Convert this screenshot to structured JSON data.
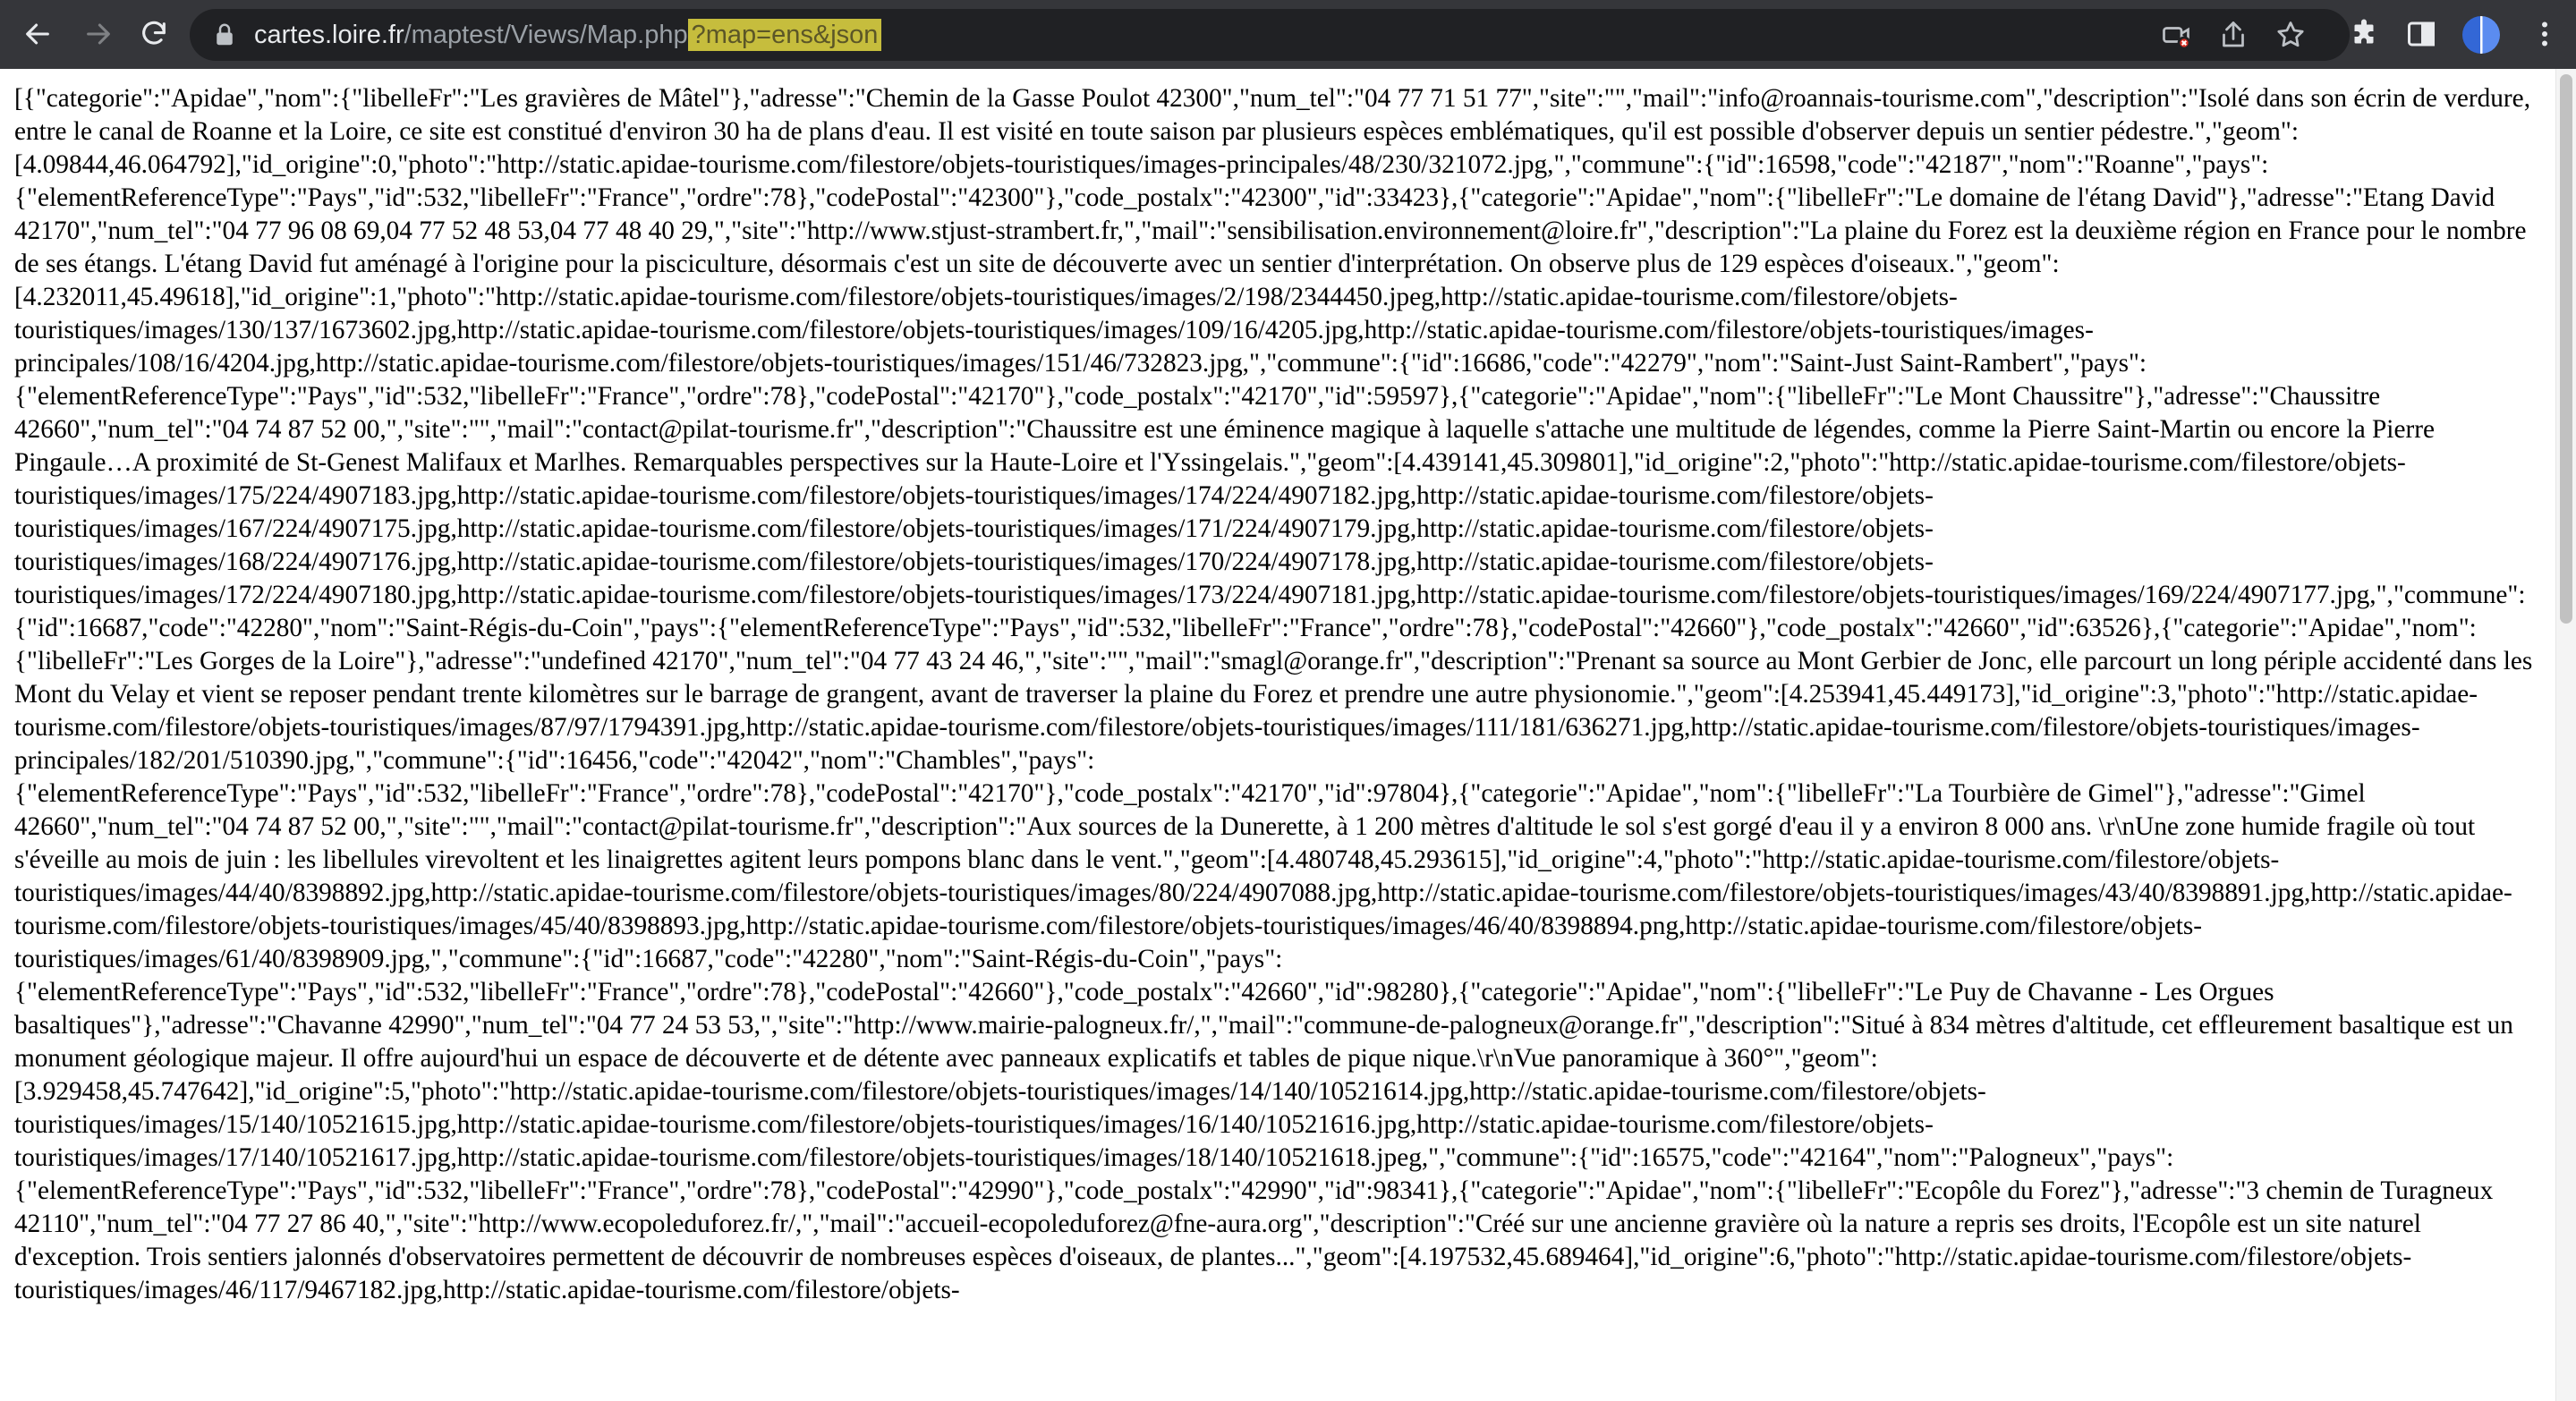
{
  "browser": {
    "url_host": "cartes.loire.fr",
    "url_path": "/maptest/Views/Map.php",
    "url_query": "?map=ens&json"
  },
  "icons": {
    "back": "arrow-left-icon",
    "forward": "arrow-right-icon",
    "reload": "reload-icon",
    "site_info": "lock-icon",
    "blocked": "camera-blocked-icon",
    "share": "share-icon",
    "bookmark": "star-icon",
    "extensions": "puzzle-icon",
    "sidebar": "side-panel-icon",
    "profile": "avatar",
    "menu": "kebab-menu-icon"
  },
  "colors": {
    "toolbar": "#35363a",
    "omnibox": "#202124",
    "highlight": "#c6bd3d"
  },
  "page": {
    "json_text": "[{\"categorie\":\"Apidae\",\"nom\":{\"libelleFr\":\"Les gravières de Mâtel\"},\"adresse\":\"Chemin de la Gasse Poulot 42300\",\"num_tel\":\"04 77 71 51 77\",\"site\":\"\",\"mail\":\"info@roannais-tourisme.com\",\"description\":\"Isolé dans son écrin de verdure, entre le canal de Roanne et la Loire, ce site est constitué d'environ 30 ha de plans d'eau. Il est visité en toute saison par plusieurs espèces emblématiques, qu'il est possible d'observer depuis un sentier pédestre.\",\"geom\":[4.09844,46.064792],\"id_origine\":0,\"photo\":\"http://static.apidae-tourisme.com/filestore/objets-touristiques/images-principales/48/230/321072.jpg,\",\"commune\":{\"id\":16598,\"code\":\"42187\",\"nom\":\"Roanne\",\"pays\":{\"elementReferenceType\":\"Pays\",\"id\":532,\"libelleFr\":\"France\",\"ordre\":78},\"codePostal\":\"42300\"},\"code_postalx\":\"42300\",\"id\":33423},{\"categorie\":\"Apidae\",\"nom\":{\"libelleFr\":\"Le domaine de l'étang David\"},\"adresse\":\"Etang David 42170\",\"num_tel\":\"04 77 96 08 69,04 77 52 48 53,04 77 48 40 29,\",\"site\":\"http://www.stjust-strambert.fr,\",\"mail\":\"sensibilisation.environnement@loire.fr\",\"description\":\"La plaine du Forez est la deuxième région en France pour le nombre de ses étangs. L'étang David fut aménagé à l'origine pour la pisciculture, désormais c'est un site de découverte avec un sentier d'interprétation. On observe plus de 129 espèces d'oiseaux.\",\"geom\":[4.232011,45.49618],\"id_origine\":1,\"photo\":\"http://static.apidae-tourisme.com/filestore/objets-touristiques/images/2/198/2344450.jpeg,http://static.apidae-tourisme.com/filestore/objets-touristiques/images/130/137/1673602.jpg,http://static.apidae-tourisme.com/filestore/objets-touristiques/images/109/16/4205.jpg,http://static.apidae-tourisme.com/filestore/objets-touristiques/images-principales/108/16/4204.jpg,http://static.apidae-tourisme.com/filestore/objets-touristiques/images/151/46/732823.jpg,\",\"commune\":{\"id\":16686,\"code\":\"42279\",\"nom\":\"Saint-Just Saint-Rambert\",\"pays\":{\"elementReferenceType\":\"Pays\",\"id\":532,\"libelleFr\":\"France\",\"ordre\":78},\"codePostal\":\"42170\"},\"code_postalx\":\"42170\",\"id\":59597},{\"categorie\":\"Apidae\",\"nom\":{\"libelleFr\":\"Le Mont Chaussitre\"},\"adresse\":\"Chaussitre 42660\",\"num_tel\":\"04 74 87 52 00,\",\"site\":\"\",\"mail\":\"contact@pilat-tourisme.fr\",\"description\":\"Chaussitre est une éminence magique à laquelle s'attache une multitude de légendes, comme la Pierre Saint-Martin ou encore la Pierre Pingaule…A proximité de St-Genest Malifaux et Marlhes. Remarquables perspectives sur la Haute-Loire et l'Yssingelais.\",\"geom\":[4.439141,45.309801],\"id_origine\":2,\"photo\":\"http://static.apidae-tourisme.com/filestore/objets-touristiques/images/175/224/4907183.jpg,http://static.apidae-tourisme.com/filestore/objets-touristiques/images/174/224/4907182.jpg,http://static.apidae-tourisme.com/filestore/objets-touristiques/images/167/224/4907175.jpg,http://static.apidae-tourisme.com/filestore/objets-touristiques/images/171/224/4907179.jpg,http://static.apidae-tourisme.com/filestore/objets-touristiques/images/168/224/4907176.jpg,http://static.apidae-tourisme.com/filestore/objets-touristiques/images/170/224/4907178.jpg,http://static.apidae-tourisme.com/filestore/objets-touristiques/images/172/224/4907180.jpg,http://static.apidae-tourisme.com/filestore/objets-touristiques/images/173/224/4907181.jpg,http://static.apidae-tourisme.com/filestore/objets-touristiques/images/169/224/4907177.jpg,\",\"commune\":{\"id\":16687,\"code\":\"42280\",\"nom\":\"Saint-Régis-du-Coin\",\"pays\":{\"elementReferenceType\":\"Pays\",\"id\":532,\"libelleFr\":\"France\",\"ordre\":78},\"codePostal\":\"42660\"},\"code_postalx\":\"42660\",\"id\":63526},{\"categorie\":\"Apidae\",\"nom\":{\"libelleFr\":\"Les Gorges de la Loire\"},\"adresse\":\"undefined 42170\",\"num_tel\":\"04 77 43 24 46,\",\"site\":\"\",\"mail\":\"smagl@orange.fr\",\"description\":\"Prenant sa source au Mont Gerbier de Jonc, elle parcourt un long périple accidenté dans les Mont du Velay et vient se reposer pendant trente kilomètres sur le barrage de grangent, avant de traverser la plaine du Forez et prendre une autre physionomie.\",\"geom\":[4.253941,45.449173],\"id_origine\":3,\"photo\":\"http://static.apidae-tourisme.com/filestore/objets-touristiques/images/87/97/1794391.jpg,http://static.apidae-tourisme.com/filestore/objets-touristiques/images/111/181/636271.jpg,http://static.apidae-tourisme.com/filestore/objets-touristiques/images-principales/182/201/510390.jpg,\",\"commune\":{\"id\":16456,\"code\":\"42042\",\"nom\":\"Chambles\",\"pays\":{\"elementReferenceType\":\"Pays\",\"id\":532,\"libelleFr\":\"France\",\"ordre\":78},\"codePostal\":\"42170\"},\"code_postalx\":\"42170\",\"id\":97804},{\"categorie\":\"Apidae\",\"nom\":{\"libelleFr\":\"La Tourbière de Gimel\"},\"adresse\":\"Gimel 42660\",\"num_tel\":\"04 74 87 52 00,\",\"site\":\"\",\"mail\":\"contact@pilat-tourisme.fr\",\"description\":\"Aux sources de la Dunerette, à 1 200 mètres d'altitude le sol s'est gorgé d'eau il y a environ 8 000 ans. \\r\\nUne zone humide fragile où tout s'éveille au mois de juin : les libellules virevoltent et les linaigrettes agitent leurs pompons blanc dans le vent.\",\"geom\":[4.480748,45.293615],\"id_origine\":4,\"photo\":\"http://static.apidae-tourisme.com/filestore/objets-touristiques/images/44/40/8398892.jpg,http://static.apidae-tourisme.com/filestore/objets-touristiques/images/80/224/4907088.jpg,http://static.apidae-tourisme.com/filestore/objets-touristiques/images/43/40/8398891.jpg,http://static.apidae-tourisme.com/filestore/objets-touristiques/images/45/40/8398893.jpg,http://static.apidae-tourisme.com/filestore/objets-touristiques/images/46/40/8398894.png,http://static.apidae-tourisme.com/filestore/objets-touristiques/images/61/40/8398909.jpg,\",\"commune\":{\"id\":16687,\"code\":\"42280\",\"nom\":\"Saint-Régis-du-Coin\",\"pays\":{\"elementReferenceType\":\"Pays\",\"id\":532,\"libelleFr\":\"France\",\"ordre\":78},\"codePostal\":\"42660\"},\"code_postalx\":\"42660\",\"id\":98280},{\"categorie\":\"Apidae\",\"nom\":{\"libelleFr\":\"Le Puy de Chavanne - Les Orgues basaltiques\"},\"adresse\":\"Chavanne 42990\",\"num_tel\":\"04 77 24 53 53,\",\"site\":\"http://www.mairie-palogneux.fr/,\",\"mail\":\"commune-de-palogneux@orange.fr\",\"description\":\"Situé à 834 mètres d'altitude, cet effleurement basaltique est un monument géologique majeur. Il offre aujourd'hui un espace de découverte et de détente avec panneaux explicatifs et tables de pique nique.\\r\\nVue panoramique à 360°\",\"geom\":[3.929458,45.747642],\"id_origine\":5,\"photo\":\"http://static.apidae-tourisme.com/filestore/objets-touristiques/images/14/140/10521614.jpg,http://static.apidae-tourisme.com/filestore/objets-touristiques/images/15/140/10521615.jpg,http://static.apidae-tourisme.com/filestore/objets-touristiques/images/16/140/10521616.jpg,http://static.apidae-tourisme.com/filestore/objets-touristiques/images/17/140/10521617.jpg,http://static.apidae-tourisme.com/filestore/objets-touristiques/images/18/140/10521618.jpeg,\",\"commune\":{\"id\":16575,\"code\":\"42164\",\"nom\":\"Palogneux\",\"pays\":{\"elementReferenceType\":\"Pays\",\"id\":532,\"libelleFr\":\"France\",\"ordre\":78},\"codePostal\":\"42990\"},\"code_postalx\":\"42990\",\"id\":98341},{\"categorie\":\"Apidae\",\"nom\":{\"libelleFr\":\"Ecopôle du Forez\"},\"adresse\":\"3 chemin de Turagneux 42110\",\"num_tel\":\"04 77 27 86 40,\",\"site\":\"http://www.ecopoleduforez.fr/,\",\"mail\":\"accueil-ecopoleduforez@fne-aura.org\",\"description\":\"Créé sur une ancienne gravière où la nature a repris ses droits, l'Ecopôle est un site naturel d'exception. Trois sentiers jalonnés d'observatoires permettent de découvrir de nombreuses espèces d'oiseaux, de plantes...\",\"geom\":[4.197532,45.689464],\"id_origine\":6,\"photo\":\"http://static.apidae-tourisme.com/filestore/objets-touristiques/images/46/117/9467182.jpg,http://static.apidae-tourisme.com/filestore/objets-"
  }
}
